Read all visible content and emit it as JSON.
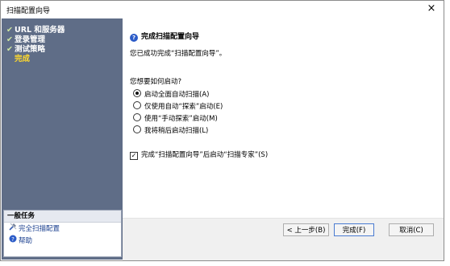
{
  "window": {
    "title": "扫描配置向导",
    "close_glyph": "×"
  },
  "sidebar": {
    "steps": [
      {
        "label": "URL 和服务器",
        "done": true
      },
      {
        "label": "登录管理",
        "done": true
      },
      {
        "label": "测试策略",
        "done": true
      },
      {
        "label": "完成",
        "done": false,
        "current": true
      }
    ],
    "tasks_header": "一般任务",
    "tasks": [
      {
        "label": "完全扫描配置",
        "icon": "tools-icon"
      },
      {
        "label": "帮助",
        "icon": "help-icon"
      }
    ]
  },
  "main": {
    "heading": "完成扫描配置向导",
    "subtitle": "您已成功完成“扫描配置向导”。",
    "question": "您想要如何启动?",
    "options": [
      {
        "label": "启动全面自动扫描(A)",
        "selected": true
      },
      {
        "label": "仅使用自动“探索”启动(E)",
        "selected": false
      },
      {
        "label": "使用“手动探索”启动(M)",
        "selected": false
      },
      {
        "label": "我将稍后启动扫描(L)",
        "selected": false
      }
    ],
    "checkbox": {
      "label": "完成“扫描配置向导”后启动“扫描专家”(S)",
      "checked": true
    }
  },
  "buttons": {
    "back": "< 上一步(B)",
    "finish": "完成(F)",
    "cancel": "取消(C)"
  },
  "colors": {
    "sidebar_bg": "#5f6d87",
    "current_step": "#ffd92c",
    "link": "#1a3f8f"
  }
}
